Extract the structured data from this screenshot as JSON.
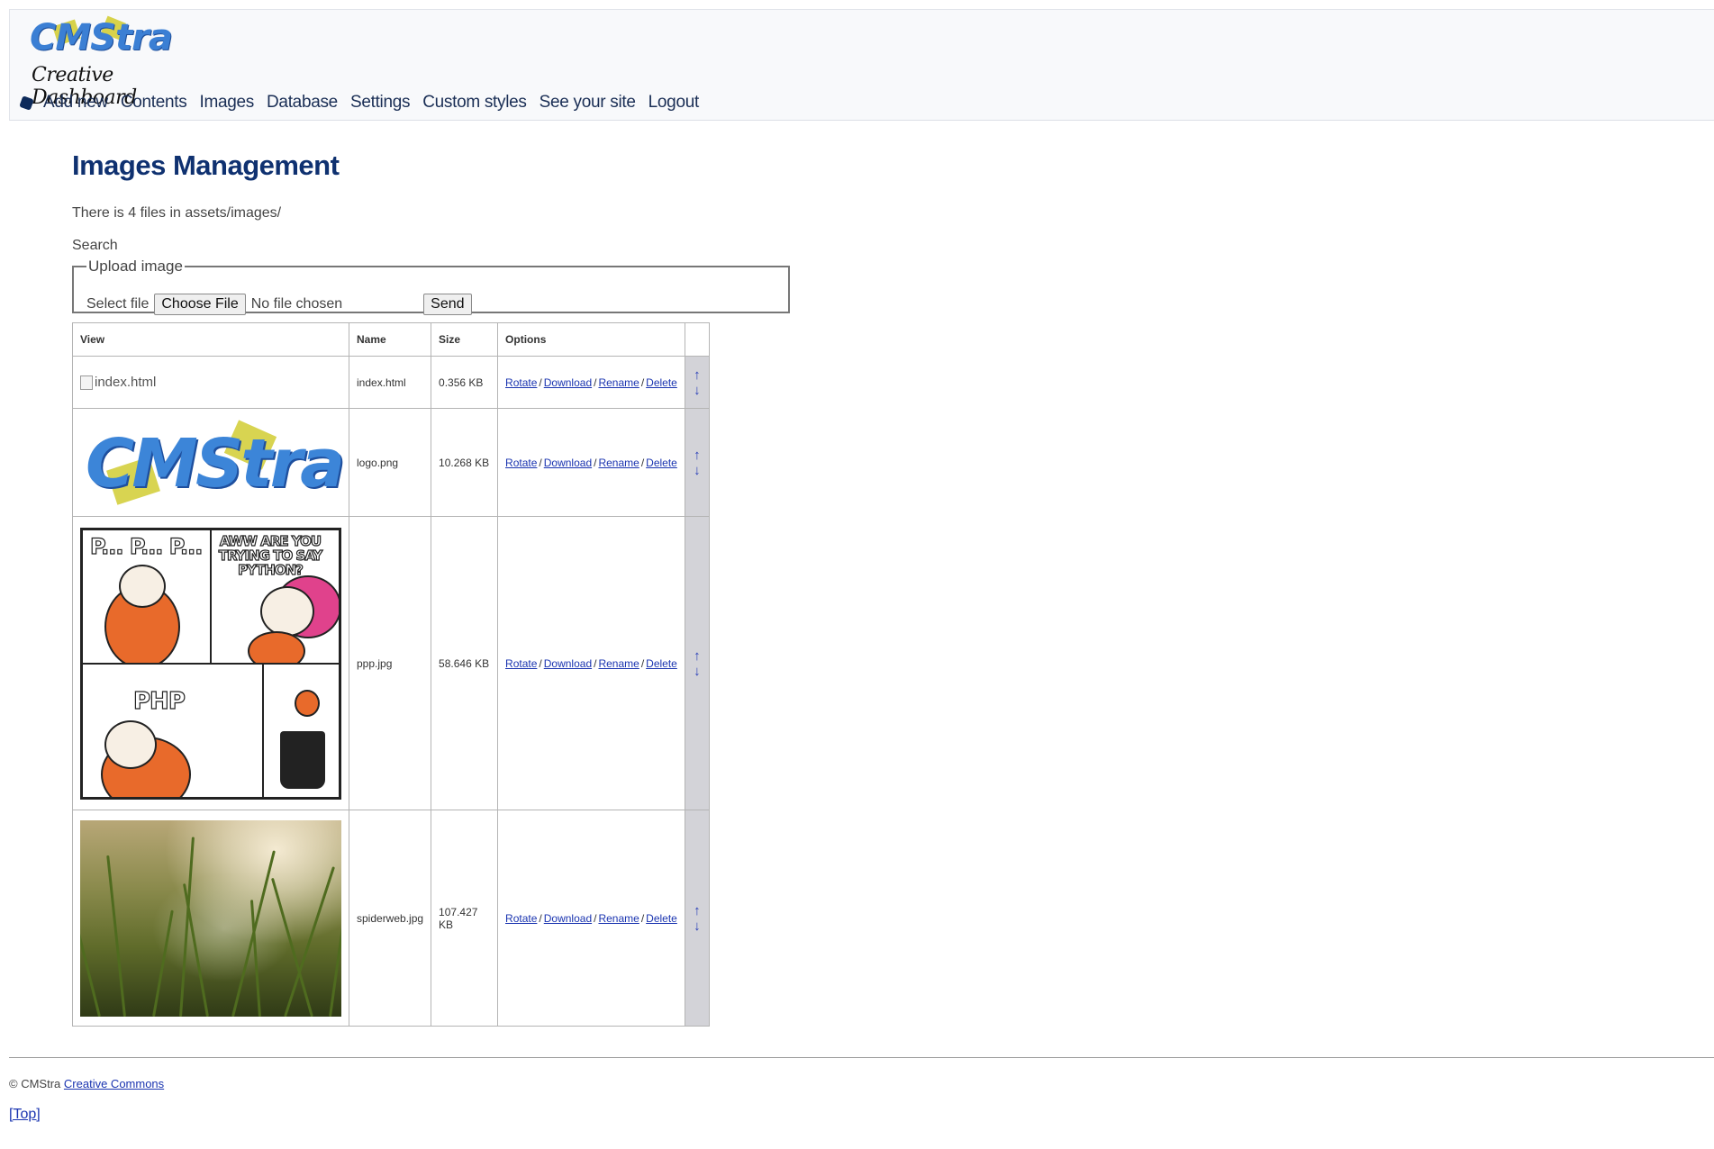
{
  "header": {
    "logo_text": "CMStra",
    "logo_subtitle": "Creative Dashboard",
    "nav": [
      "Add new",
      "Contents",
      "Images",
      "Database",
      "Settings",
      "Custom styles",
      "See your site",
      "Logout"
    ]
  },
  "page": {
    "title": "Images Management",
    "info": "There is 4 files in assets/images/",
    "search_label": "Search"
  },
  "upload": {
    "legend": "Upload image",
    "select_label": "Select file",
    "choose_button": "Choose File",
    "no_file": "No file chosen",
    "send_button": "Send"
  },
  "table": {
    "headers": [
      "View",
      "Name",
      "Size",
      "Options"
    ],
    "options": [
      "Rotate",
      "Download",
      "Rename",
      "Delete"
    ],
    "rows": [
      {
        "name": "index.html",
        "size": "0.356 KB",
        "alt": "index.html"
      },
      {
        "name": "logo.png",
        "size": "10.268 KB",
        "thumb_text": "CMStra"
      },
      {
        "name": "ppp.jpg",
        "size": "58.646 KB",
        "captions": [
          "P... P... P...",
          "AWW ARE YOU TRYING TO SAY PYTHON?",
          "PHP"
        ]
      },
      {
        "name": "spiderweb.jpg",
        "size": "107.427 KB"
      }
    ],
    "arrow_up": "↑",
    "arrow_down": "↓"
  },
  "footer": {
    "copyright_symbol": "©",
    "brand": "CMStra",
    "license_link": "Creative Commons",
    "top_link": "[Top]"
  },
  "colors": {
    "accent": "#0f3170",
    "link": "#1a34b0",
    "logo_blue": "#3b7fd4",
    "logo_yellow": "#d7d24a"
  }
}
